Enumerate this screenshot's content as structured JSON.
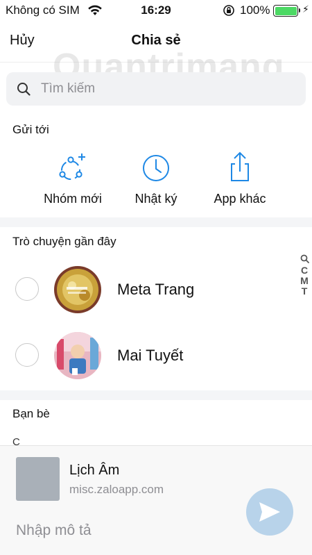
{
  "status_bar": {
    "carrier": "Không có SIM",
    "time": "16:29",
    "battery_percent": "100%",
    "icons": [
      "wifi-icon",
      "orientation-lock-icon",
      "battery-icon",
      "charging-bolt-icon"
    ]
  },
  "nav": {
    "cancel_label": "Hủy",
    "title": "Chia sẻ"
  },
  "watermark": {
    "text": "Quantrimang"
  },
  "search": {
    "placeholder": "Tìm kiếm",
    "value": ""
  },
  "send_to": {
    "title": "Gửi tới",
    "items": [
      {
        "label": "Nhóm mới",
        "icon": "new-group-icon"
      },
      {
        "label": "Nhật ký",
        "icon": "clock-icon"
      },
      {
        "label": "App khác",
        "icon": "share-icon"
      }
    ]
  },
  "recent_chats": {
    "title": "Trò chuyện gần đây",
    "items": [
      {
        "name": "Meta Trang",
        "selected": false
      },
      {
        "name": "Mai Tuyết",
        "selected": false
      }
    ]
  },
  "index_bar": {
    "letters": [
      "C",
      "M",
      "T"
    ]
  },
  "friends": {
    "title": "Bạn bè",
    "first_letter": "C"
  },
  "footer": {
    "link_title": "Lịch Âm",
    "link_url": "misc.zaloapp.com",
    "description_placeholder": "Nhập mô tả",
    "description_value": ""
  },
  "colors": {
    "accent": "#1e88e5",
    "send_button": "#b8d3ea",
    "battery": "#4cd964",
    "divider": "#f4f5f7"
  }
}
